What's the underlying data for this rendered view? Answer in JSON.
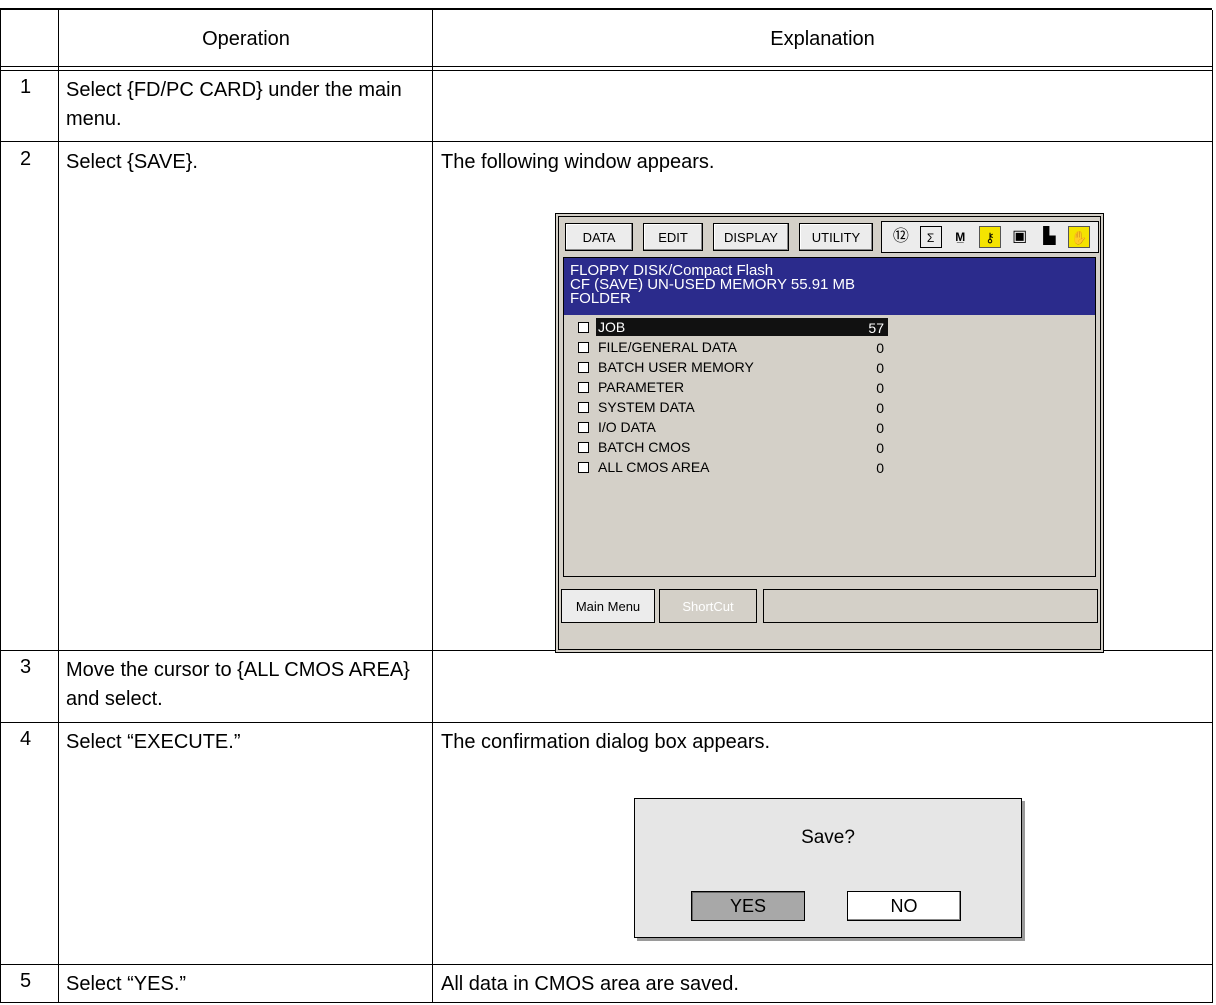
{
  "table": {
    "headers": {
      "operation": "Operation",
      "explanation": "Explanation"
    },
    "rows": [
      {
        "num": "1",
        "operation": "Select {FD/PC CARD} under the main menu.",
        "explanation": ""
      },
      {
        "num": "2",
        "operation": "Select {SAVE}.",
        "explanation": "The following window appears."
      },
      {
        "num": "3",
        "operation": "Move the cursor to {ALL CMOS AREA} and select.",
        "explanation": ""
      },
      {
        "num": "4",
        "operation": "Select “EXECUTE.”",
        "explanation": "The confirmation dialog box appears."
      },
      {
        "num": "5",
        "operation": "Select “YES.”",
        "explanation": "All data in CMOS area are saved."
      }
    ]
  },
  "pendant": {
    "menu": [
      "DATA",
      "EDIT",
      "DISPLAY",
      "UTILITY"
    ],
    "status_icons": [
      "tool-number-icon",
      "sigma-icon",
      "m1-icon",
      "key-icon",
      "screen-icon",
      "flag-icon",
      "hand-icon"
    ],
    "title_lines": [
      "FLOPPY DISK/Compact Flash",
      "CF (SAVE) UN-USED MEMORY 55.91 MB",
      "FOLDER"
    ],
    "items": [
      {
        "label": "JOB",
        "count": "57",
        "selected": true
      },
      {
        "label": "FILE/GENERAL DATA",
        "count": "0"
      },
      {
        "label": "BATCH USER MEMORY",
        "count": "0"
      },
      {
        "label": "PARAMETER",
        "count": "0"
      },
      {
        "label": "SYSTEM DATA",
        "count": "0"
      },
      {
        "label": "I/O DATA",
        "count": "0"
      },
      {
        "label": "BATCH CMOS",
        "count": "0"
      },
      {
        "label": "ALL CMOS AREA",
        "count": "0"
      }
    ],
    "bottom": {
      "main_menu": "Main Menu",
      "shortcut": "ShortCut"
    },
    "colors": {
      "title_bg": "#2b2b8c",
      "panel_bg": "#d4d0c8"
    }
  },
  "dialog": {
    "message": "Save?",
    "yes": "YES",
    "no": "NO"
  }
}
